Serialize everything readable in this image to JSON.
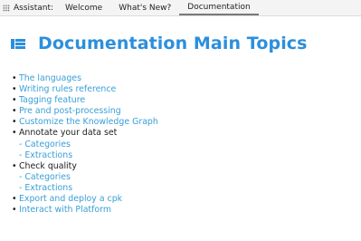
{
  "tabbar": {
    "assistant_label": "Assistant:",
    "tabs": [
      {
        "label": "Welcome",
        "active": false
      },
      {
        "label": "What's New?",
        "active": false
      },
      {
        "label": "Documentation",
        "active": true
      }
    ]
  },
  "page": {
    "title": "Documentation Main Topics"
  },
  "topics": {
    "the_languages": "The languages",
    "writing_rules_reference": "Writing rules reference",
    "tagging_feature": "Tagging feature",
    "pre_post_processing": "Pre and post-processing",
    "customize_knowledge_graph": "Customize the Knowledge Graph",
    "annotate_dataset": "Annotate your data set",
    "annotate_categories": "- Categories",
    "annotate_extractions": "- Extractions",
    "check_quality": "Check quality",
    "check_categories": "- Categories",
    "check_extractions": "- Extractions",
    "export_deploy": "Export and deploy a cpk",
    "interact_platform": "Interact with Platform"
  },
  "colors": {
    "accent": "#2c8fdc",
    "link": "#3a9fd8",
    "text": "#222222"
  },
  "icons": {
    "grip": "grip-dots-icon",
    "title": "list-icon"
  }
}
